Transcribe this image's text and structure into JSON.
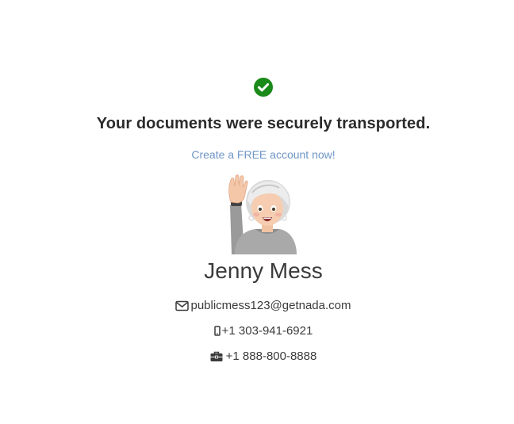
{
  "confirmation": {
    "icon": "check-circle-icon",
    "headline": "Your documents were securely transported."
  },
  "signup": {
    "label": "Create a FREE account now!"
  },
  "contact": {
    "avatar": "memoji-waving-avatar",
    "name": "Jenny Mess",
    "email": "publicmess123@getnada.com",
    "mobile": "+1 303-941-6921",
    "work_phone": "+1 888-800-8888"
  },
  "colors": {
    "success": "#1a8a1a",
    "link": "#6e96c6",
    "text": "#3a3a3a"
  }
}
